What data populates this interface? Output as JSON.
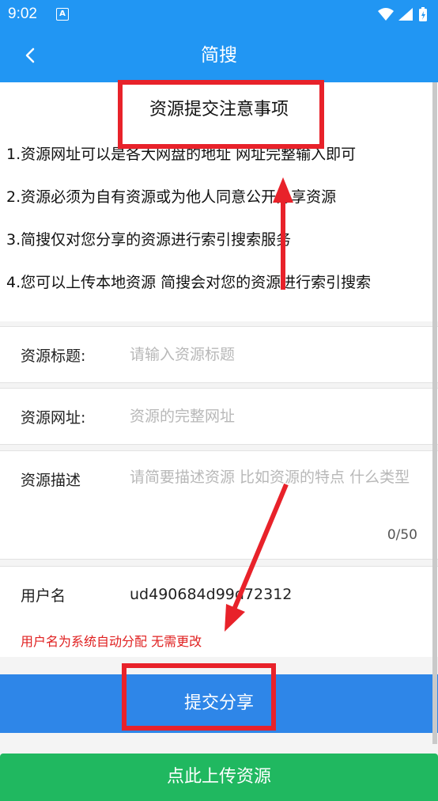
{
  "status_bar": {
    "time": "9:02",
    "notification_icon": "A"
  },
  "app_bar": {
    "title": "简搜",
    "back_icon": "chevron-left-icon"
  },
  "notice": {
    "title": "资源提交注意事项",
    "items": [
      "1.资源网址可以是各大网盘的地址 网址完整输入即可",
      "2.资源必须为自有资源或为他人同意公开分享资源",
      "3.简搜仅对您分享的资源进行索引搜索服务",
      "4.您可以上传本地资源 简搜会对您的资源进行索引搜索"
    ]
  },
  "form": {
    "title_field": {
      "label": "资源标题:",
      "placeholder": "请输入资源标题"
    },
    "url_field": {
      "label": "资源网址:",
      "placeholder": "资源的完整网址"
    },
    "description_field": {
      "label": "资源描述",
      "placeholder": "请简要描述资源 比如资源的特点 什么类型",
      "counter": "0/50"
    },
    "username_field": {
      "label": "用户名",
      "value": "ud490684d99d72312"
    },
    "username_note": "用户名为系统自动分配 无需更改"
  },
  "buttons": {
    "submit": "提交分享",
    "upload": "点此上传资源"
  },
  "colors": {
    "primary": "#2196f3",
    "submit": "#2e86e8",
    "upload": "#20b860",
    "annotation": "#e8222a",
    "warning": "#e02020"
  }
}
